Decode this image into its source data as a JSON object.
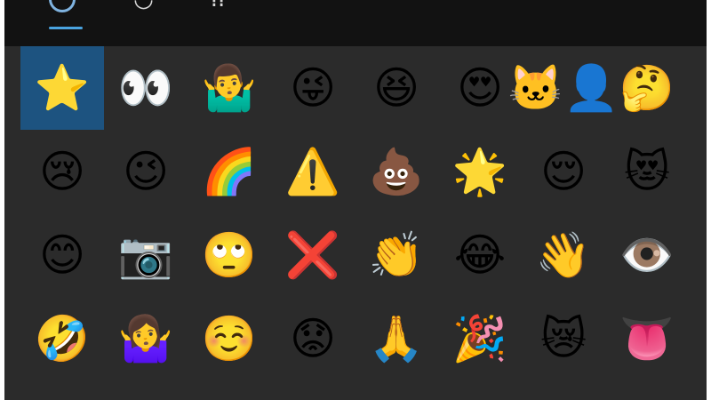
{
  "tabs": [
    {
      "name": "tab-recent",
      "icon": "clock-icon",
      "glyph": ""
    },
    {
      "name": "tab-kaomoji",
      "icon": "kaomoji-icon",
      "glyph": "˙◡"
    },
    {
      "name": "tab-symbols",
      "icon": "symbols-icon",
      "glyph": "⁞⁞"
    }
  ],
  "accent_color": "#4aa3df",
  "selected_color": "#1d5380",
  "emoji_grid": [
    {
      "name": "star-emoji",
      "char": "⭐"
    },
    {
      "name": "eyes-emoji",
      "char": "👀"
    },
    {
      "name": "person-shrugging-emoji",
      "char": "🤷‍♂️"
    },
    {
      "name": "winking-tongue-face-emoji",
      "char": "😜"
    },
    {
      "name": "grinning-squinting-face-emoji",
      "char": "😆"
    },
    {
      "name": "heart-eyes-face-emoji",
      "char": "😍"
    },
    {
      "name": "ninja-cat-emoji",
      "char": "🐱‍👤"
    },
    {
      "name": "thinking-face-emoji",
      "char": "🤔"
    },
    {
      "name": "crying-face-emoji",
      "char": "😢"
    },
    {
      "name": "winking-face-emoji",
      "char": "😉"
    },
    {
      "name": "rainbow-emoji",
      "char": "🌈"
    },
    {
      "name": "warning-emoji",
      "char": "⚠️"
    },
    {
      "name": "pile-of-poo-emoji",
      "char": "💩"
    },
    {
      "name": "glowing-star-emoji",
      "char": "🌟"
    },
    {
      "name": "relieved-face-emoji",
      "char": "😌"
    },
    {
      "name": "heart-eyes-cat-emoji",
      "char": "😻"
    },
    {
      "name": "smiling-face-emoji",
      "char": "😊"
    },
    {
      "name": "camera-emoji",
      "char": "📷"
    },
    {
      "name": "rolling-eyes-face-emoji",
      "char": "🙄"
    },
    {
      "name": "cross-mark-emoji",
      "char": "❌"
    },
    {
      "name": "clapping-hands-emoji",
      "char": "👏"
    },
    {
      "name": "tears-of-joy-face-emoji",
      "char": "😂"
    },
    {
      "name": "waving-hand-emoji",
      "char": "👋"
    },
    {
      "name": "eye-emoji",
      "char": "👁️"
    },
    {
      "name": "rolling-laughing-face-emoji",
      "char": "🤣"
    },
    {
      "name": "woman-shrugging-emoji",
      "char": "🤷‍♀️"
    },
    {
      "name": "smiling-blush-face-emoji",
      "char": "☺️"
    },
    {
      "name": "worried-face-emoji",
      "char": "😟"
    },
    {
      "name": "folded-hands-emoji",
      "char": "🙏"
    },
    {
      "name": "party-popper-emoji",
      "char": "🎉"
    },
    {
      "name": "cat-with-mask-emoji",
      "char": "😿"
    },
    {
      "name": "tongue-emoji",
      "char": "👅"
    }
  ]
}
